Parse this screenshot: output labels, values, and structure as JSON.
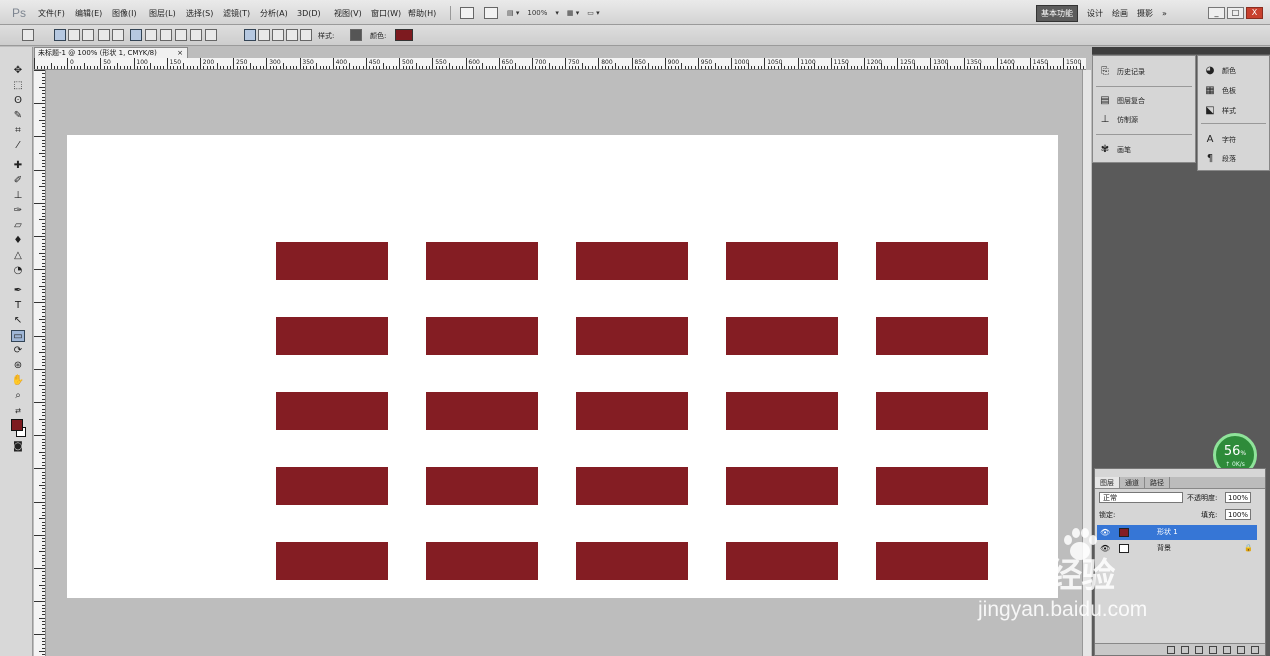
{
  "app": {
    "logo": "Ps"
  },
  "menu": [
    "文件(F)",
    "编辑(E)",
    "图像(I)",
    "图层(L)",
    "选择(S)",
    "滤镜(T)",
    "分析(A)",
    "3D(D)",
    "视图(V)",
    "窗口(W)",
    "帮助(H)"
  ],
  "menu_tools": {
    "zoom": "100%"
  },
  "workspace": {
    "active": "基本功能",
    "items": [
      "设计",
      "绘画",
      "摄影",
      "»"
    ]
  },
  "window_controls": [
    "_",
    "□",
    "X"
  ],
  "options": {
    "mode_label": "样式:",
    "color_label": "颜色:",
    "color": "#7d1a1f"
  },
  "document": {
    "tab_title": "未标题-1 @ 100% (形状 1, CMYK/8)",
    "tab_close": "×"
  },
  "ruler_labels": [
    "0",
    "50",
    "100",
    "150",
    "200",
    "250",
    "300",
    "350",
    "400",
    "450",
    "500",
    "550",
    "600",
    "650",
    "700",
    "750",
    "800",
    "850",
    "900",
    "950",
    "1000",
    "1050",
    "1100",
    "1150",
    "1200",
    "1250",
    "1300",
    "1350",
    "1400",
    "1450",
    "1500"
  ],
  "canvas": {
    "background": "#ffffff",
    "shape_color": "#841d23",
    "grid_rows": 5,
    "grid_cols": 5
  },
  "panels": {
    "col1": [
      {
        "icon": "history-icon",
        "label": "历史记录"
      },
      {
        "icon": "layer-comps-icon",
        "label": "图层复合"
      },
      {
        "icon": "tool-presets-icon",
        "label": "仿制源"
      },
      {
        "icon": "brush-icon",
        "label": "画笔"
      }
    ],
    "col2": [
      {
        "icon": "color-icon",
        "label": "颜色"
      },
      {
        "icon": "swatches-icon",
        "label": "色板"
      },
      {
        "icon": "styles-icon",
        "label": "样式"
      },
      {
        "icon": "character-icon",
        "label": "字符"
      },
      {
        "icon": "paragraph-icon",
        "label": "段落"
      }
    ]
  },
  "progress": {
    "value": "56",
    "unit": "%",
    "sub": "↑ 0K/s"
  },
  "layers": {
    "tabs": [
      "图层",
      "通道",
      "路径"
    ],
    "blend_mode": "正常",
    "opacity_label": "不透明度:",
    "opacity": "100%",
    "lock_label": "锁定:",
    "fill_label": "填充:",
    "fill": "100%",
    "rows": [
      {
        "name": "形状 1",
        "thumb_color": "#841d23",
        "selected": true,
        "lock": ""
      },
      {
        "name": "背景",
        "thumb_color": "#ffffff",
        "selected": false,
        "lock": "🔒"
      }
    ]
  },
  "watermark": {
    "brand": "Bai 经验",
    "url": "jingyan.baidu.com"
  }
}
